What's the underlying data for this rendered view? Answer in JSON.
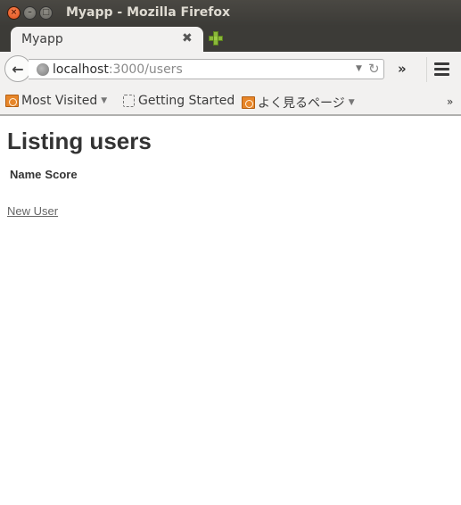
{
  "window": {
    "title": "Myapp - Mozilla Firefox",
    "buttons": {
      "close": "×",
      "minimize": "–",
      "maximize": "□"
    }
  },
  "tabs": [
    {
      "label": "Myapp",
      "close_glyph": "✖",
      "active": true
    }
  ],
  "navbar": {
    "back_glyph": "🡐",
    "url_host": "localhost",
    "url_rest": ":3000/users",
    "dropdown_glyph": "▼",
    "reload_glyph": "↻",
    "overflow_glyph": "»"
  },
  "bookmarks": {
    "items": [
      {
        "label": "Most Visited",
        "icon": "smart-folder-icon",
        "has_dropdown": true
      },
      {
        "label": "Getting Started",
        "icon": "dotted-page-icon",
        "has_dropdown": false
      },
      {
        "label": "よく見るページ",
        "icon": "smart-folder-icon",
        "has_dropdown": true
      }
    ],
    "dropdown_glyph": "▼",
    "more_glyph": "»"
  },
  "page": {
    "heading": "Listing users",
    "table_headers": [
      "Name",
      "Score"
    ],
    "table_rows": [],
    "new_user_link": "New User"
  }
}
